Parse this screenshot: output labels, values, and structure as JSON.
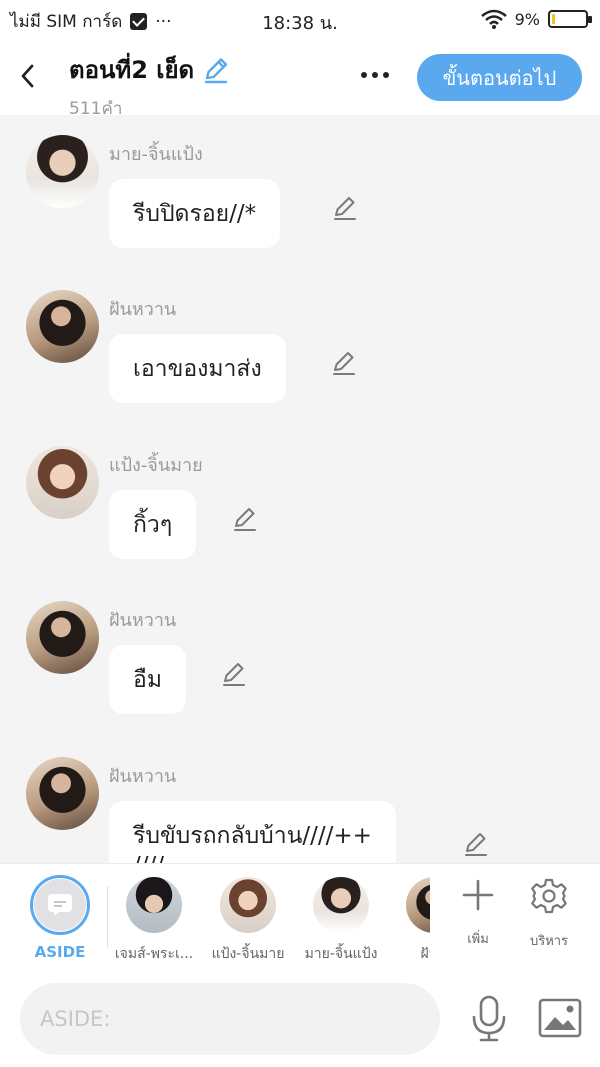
{
  "status_bar": {
    "carrier": "ไม่มี SIM การ์ด",
    "dots": "···",
    "time": "18:38 น.",
    "battery_percent": "9%",
    "battery_level": 0.09
  },
  "header": {
    "title": "ตอนที่2 เย็ด",
    "word_count": "511คำ",
    "next_label": "ขั้นตอนต่อไป"
  },
  "messages": [
    {
      "sender": "มาย-จิ้นแป้ง",
      "text": "รีบปิดรอย//*"
    },
    {
      "sender": "ฝันหวาน",
      "text": "เอาของมาส่ง"
    },
    {
      "sender": "แป้ง-จิ้นมาย",
      "text": "กิ้วๆ"
    },
    {
      "sender": "ฝันหวาน",
      "text": "อืม"
    },
    {
      "sender": "ฝันหวาน",
      "text": "รีบขับรถกลับบ้าน////++",
      "text_line2": "////"
    }
  ],
  "characters": {
    "aside_label": "ASIDE",
    "items": [
      {
        "name": "เจมส์-พระเ..."
      },
      {
        "name": "แป้ง-จิ้นมาย"
      },
      {
        "name": "มาย-จิ้นแป้ง"
      },
      {
        "name": "ฝันห"
      }
    ],
    "add_label": "เพิ่ม",
    "manage_label": "บริหาร"
  },
  "input": {
    "placeholder": "ASIDE:"
  },
  "colors": {
    "accent": "#5aa9ef",
    "chat_bg": "#f4f4f5",
    "battery": "#f0c419"
  }
}
